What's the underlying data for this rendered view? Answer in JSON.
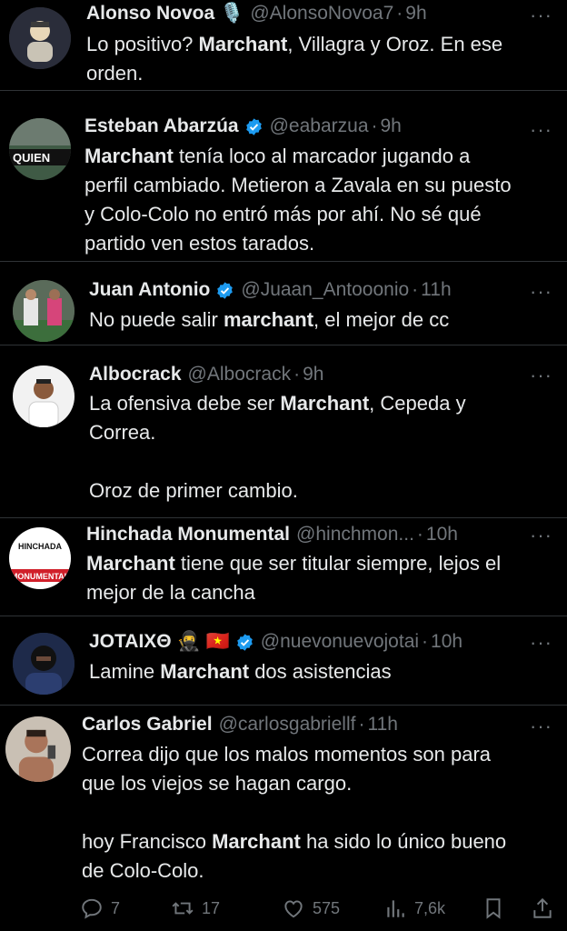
{
  "tweets": [
    {
      "name": "Alonso Novoa",
      "badge": "🎙️",
      "handle": "@AlonsoNovoa7",
      "time": "9h",
      "segments": [
        {
          "t": "Lo positivo? "
        },
        {
          "t": "Marchant",
          "b": true
        },
        {
          "t": ", Villagra y Oroz. En ese\norden."
        }
      ]
    },
    {
      "name": "Esteban Abarzúa",
      "verified": true,
      "handle": "@eabarzua",
      "time": "9h",
      "avatar_text": "QUIEN",
      "segments": [
        {
          "t": "Marchant",
          "b": true
        },
        {
          "t": " tenía loco al marcador jugando a\nperfil cambiado. Metieron a Zavala en su puesto\ny Colo-Colo no entró más por ahí. No sé qué\npartido ven estos tarados."
        }
      ]
    },
    {
      "name": "Juan Antonio",
      "verified": true,
      "handle": "@Juaan_Antooonio",
      "time": "11h",
      "segments": [
        {
          "t": "No puede salir "
        },
        {
          "t": "marchant",
          "b": true
        },
        {
          "t": ", el mejor de cc"
        }
      ]
    },
    {
      "name": "Albocrack",
      "handle": "@Albocrack",
      "time": "9h",
      "segments": [
        {
          "t": "La ofensiva debe ser "
        },
        {
          "t": "Marchant",
          "b": true
        },
        {
          "t": ", Cepeda y\nCorrea.\n\nOroz de primer cambio."
        }
      ]
    },
    {
      "name": "Hinchada Monumental",
      "handle": "@hinchmon...",
      "time": "10h",
      "avatar_text_top": "HINCHADA",
      "avatar_text_bottom": "MONUMENTAL",
      "segments": [
        {
          "t": "Marchant",
          "b": true
        },
        {
          "t": " tiene que ser titular siempre, lejos el\nmejor de la cancha"
        }
      ]
    },
    {
      "name": "JOTAIXΘ",
      "badge": "🥷 🇻🇳",
      "verified": true,
      "handle": "@nuevonuevojotai",
      "time": "10h",
      "segments": [
        {
          "t": "Lamine "
        },
        {
          "t": "Marchant",
          "b": true
        },
        {
          "t": " dos asistencias"
        }
      ]
    },
    {
      "name": "Carlos Gabriel",
      "handle": "@carlosgabriellf",
      "time": "11h",
      "segments": [
        {
          "t": "Correa dijo que los malos momentos son para\nque los viejos se hagan cargo.\n\nhoy Francisco "
        },
        {
          "t": "Marchant",
          "b": true
        },
        {
          "t": " ha sido lo único bueno\nde Colo-Colo."
        }
      ]
    }
  ],
  "dot": "·",
  "more": "···",
  "actions": {
    "replies": "7",
    "retweets": "17",
    "likes": "575",
    "views": "7,6k"
  },
  "colors": {
    "background": "#000000",
    "text": "#e7e9ea",
    "muted": "#71767b",
    "verified": "#1d9bf0",
    "divider": "#2f3336"
  },
  "icons": [
    "reply-icon",
    "retweet-icon",
    "like-icon",
    "views-icon",
    "bookmark-icon",
    "share-icon",
    "verified-badge-icon",
    "more-icon"
  ]
}
